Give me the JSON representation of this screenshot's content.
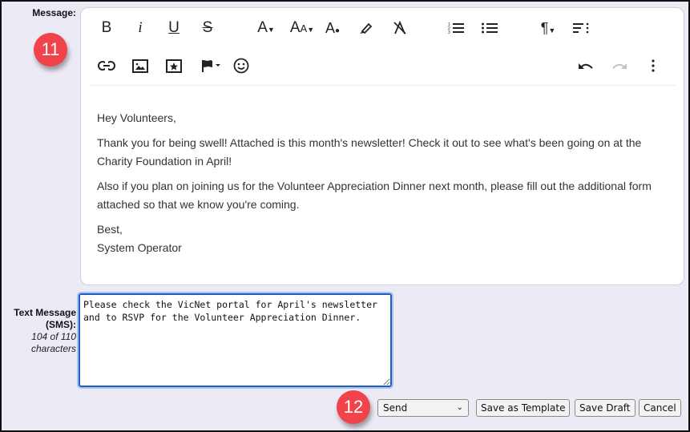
{
  "labels": {
    "message": "Message:",
    "sms_line1": "Text Message",
    "sms_line2": "(SMS):",
    "sms_count_line1": "104 of 110",
    "sms_count_line2": "characters"
  },
  "badges": {
    "step1": "11",
    "step2": "12"
  },
  "toolbar": {
    "row1": [
      "bold-icon",
      "italic-icon",
      "underline-icon",
      "strikethrough-icon",
      "font-family-icon",
      "font-size-icon",
      "text-color-icon",
      "highlight-icon",
      "clear-format-icon",
      "ordered-list-icon",
      "unordered-list-icon",
      "paragraph-icon",
      "align-icon"
    ],
    "row2": [
      "link-icon",
      "image-icon",
      "video-icon",
      "flag-icon",
      "emoji-icon",
      "undo-icon",
      "redo-icon",
      "more-icon"
    ]
  },
  "editor": {
    "paragraphs": [
      "Hey Volunteers,",
      "Thank you for being swell! Attached is this month's newsletter! Check it out to see what's been going on at the Charity Foundation in April!",
      "Also if you plan on joining us for the Volunteer Appreciation Dinner next month, please fill out the additional form attached so that we know you're coming.",
      "Best,",
      "System Operator"
    ]
  },
  "sms": {
    "value": "Please check the VicNet portal for April's newsletter and to RSVP for the Volunteer Appreciation Dinner."
  },
  "actions": {
    "send_select": "Send",
    "save_template": "Save as Template",
    "save_draft": "Save Draft",
    "cancel": "Cancel"
  },
  "colors": {
    "badge": "#f0434a",
    "background": "#ecebf5",
    "focus": "#1f5fbf"
  }
}
